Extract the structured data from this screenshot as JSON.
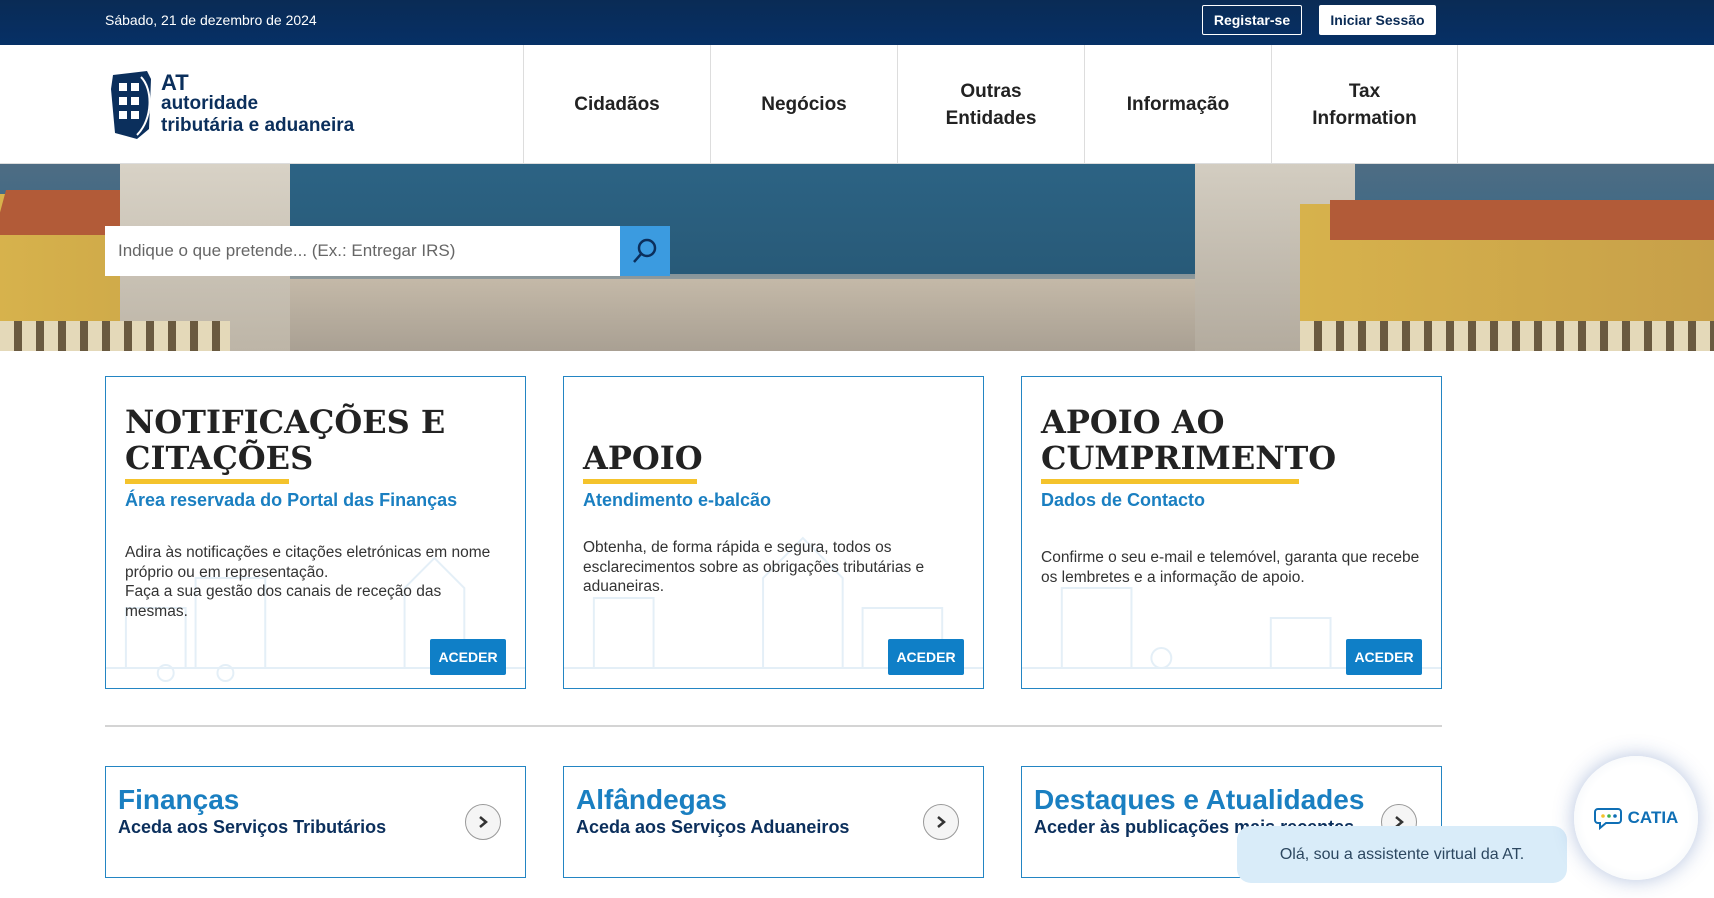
{
  "topbar": {
    "date": "Sábado, 21 de dezembro de 2024",
    "register": "Registar-se",
    "login": "Iniciar Sessão"
  },
  "logo": {
    "line1": "AT",
    "line2": "autoridade",
    "line3": "tributária e aduaneira"
  },
  "nav": [
    "Cidadãos",
    "Negócios",
    "Outras\nEntidades",
    "Informação",
    "Tax\nInformation"
  ],
  "search": {
    "placeholder": "Indique o que pretende... (Ex.: Entregar IRS)"
  },
  "cards": [
    {
      "title1": "NOTIFICAÇÕES E",
      "title2": "CITAÇÕES",
      "subtitle": "Área reservada do Portal das Finanças",
      "desc": "Adira às notificações e citações eletrónicas em nome próprio ou em representação.\nFaça a sua gestão dos canais de receção das mesmas.",
      "button": "ACEDER"
    },
    {
      "title1": "",
      "title2": "APOIO",
      "subtitle": "Atendimento e-balcão",
      "desc": "Obtenha, de forma rápida e segura, todos os esclarecimentos sobre as obrigações tributárias e aduaneiras.",
      "button": "ACEDER"
    },
    {
      "title1": "APOIO AO",
      "title2": "CUMPRIMENTO",
      "subtitle": "Dados de Contacto",
      "desc": "Confirme o seu e-mail e telemóvel, garanta que recebe os lembretes e a informação de apoio.",
      "button": "ACEDER"
    }
  ],
  "links": [
    {
      "title": "Finanças",
      "subtitle": "Aceda aos Serviços Tributários"
    },
    {
      "title": "Alfândegas",
      "subtitle": "Aceda aos Serviços Aduaneiros"
    },
    {
      "title": "Destaques e Atualidades",
      "subtitle": "Aceder às publicações mais recentes"
    }
  ],
  "chat": {
    "message": "Olá, sou a assistente virtual da AT.",
    "name": "CATIA"
  },
  "colors": {
    "navy": "#0a2b55",
    "accent_blue": "#1a7fc1",
    "button_blue": "#0f7fc7",
    "underline_yellow": "#f4c32c"
  }
}
